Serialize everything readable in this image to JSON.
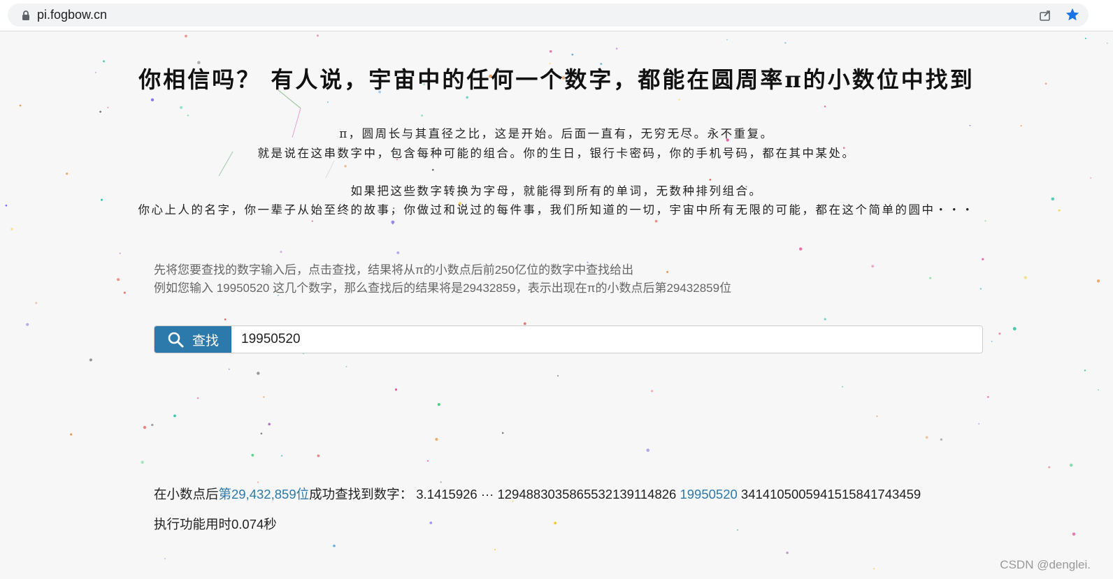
{
  "browser": {
    "url": "pi.fogbow.cn",
    "icons": [
      "lock-icon",
      "share-icon",
      "bookmark-star-icon"
    ],
    "accent_color": "#1a73e8"
  },
  "header": {
    "headline": "你相信吗？ 有人说，宇宙中的任何一个数字，都能在圆周率π的小数位中找到"
  },
  "poem": {
    "line1": "π，圆周长与其直径之比，这是开始。后面一直有，无穷无尽。永不重复。",
    "line2": "就是说在这串数字中，包含每种可能的组合。你的生日，银行卡密码，你的手机号码，都在其中某处。",
    "line3": "如果把这些数字转换为字母，就能得到所有的单词，无数种排列组合。",
    "line4": "你心上人的名字，你一辈子从始至终的故事，你做过和说过的每件事，我们所知道的一切，宇宙中所有无限的可能，都在这个简单的圆中・・・"
  },
  "intro": {
    "line1": "先将您要查找的数字输入后，点击查找，结果将从π的小数点后前250亿位的数字中查找给出",
    "line2": "例如您输入 19950520 这几个数字，那么查找后的结果将是29432859，表示出现在π的小数点后第29432859位"
  },
  "search": {
    "button_label": "查找",
    "value": "19950520",
    "button_color": "#2b7aab"
  },
  "result": {
    "prefix": "在小数点后",
    "position": "第29,432,859位",
    "middle": "成功查找到数字：",
    "pi_start": "3.1415926 ··· 12948830358655321391148 26",
    "before": "3.1415926 ··· 1294883035865532139114826",
    "match": "19950520",
    "after": "34141050059415158417 43459"
  },
  "result_display": {
    "before": "3.1415926 ··· 1294883035865532139114826",
    "after": "3414105005941515841743459"
  },
  "timing": "执行功能用时0.074秒",
  "watermark": "CSDN @denglei."
}
